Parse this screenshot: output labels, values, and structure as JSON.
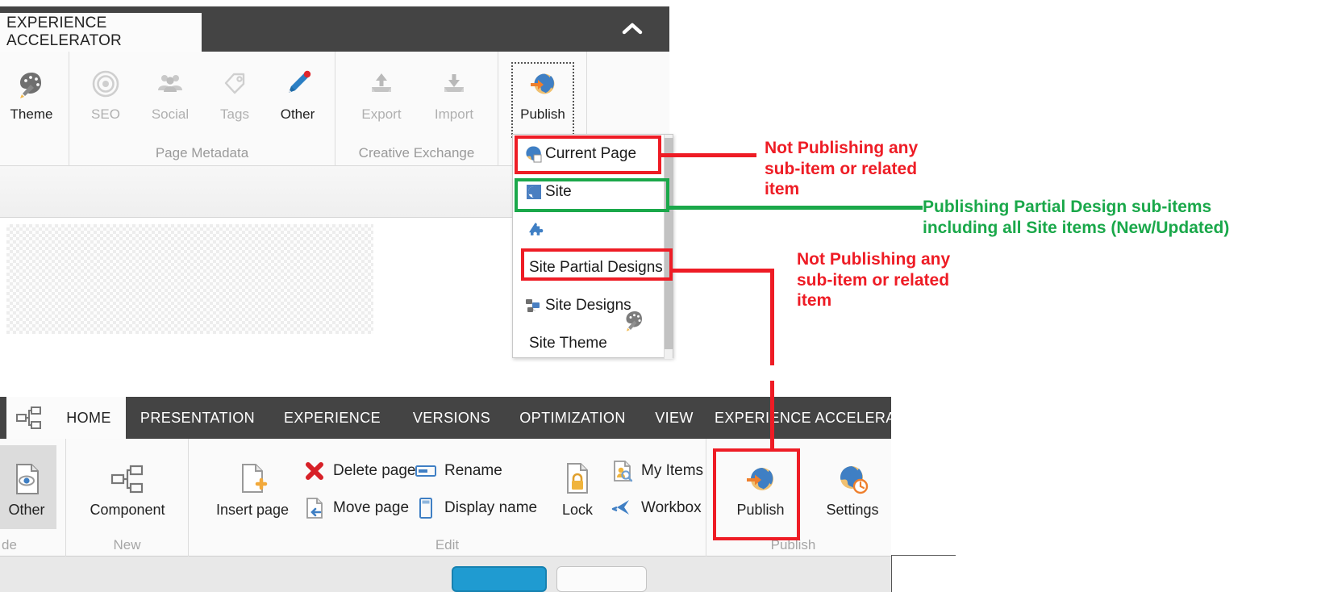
{
  "top_ribbon": {
    "tab_label": "EXPERIENCE ACCELERATOR",
    "collapse_icon": "chevron-up-icon",
    "groups": [
      {
        "label": "",
        "buttons": [
          {
            "label": "Theme",
            "icon": "palette-icon",
            "enabled": true
          }
        ]
      },
      {
        "label": "Page Metadata",
        "buttons": [
          {
            "label": "SEO",
            "icon": "target-icon",
            "enabled": false
          },
          {
            "label": "Social",
            "icon": "people-icon",
            "enabled": false
          },
          {
            "label": "Tags",
            "icon": "tag-icon",
            "enabled": false
          },
          {
            "label": "Other",
            "icon": "pencil-icon",
            "enabled": true
          }
        ]
      },
      {
        "label": "Creative Exchange",
        "buttons": [
          {
            "label": "Export",
            "icon": "export-up-icon",
            "enabled": false
          },
          {
            "label": "Import",
            "icon": "import-down-icon",
            "enabled": false
          }
        ]
      },
      {
        "label": "",
        "buttons": [
          {
            "label": "Publish",
            "icon": "globe-publish-icon",
            "enabled": true,
            "selected": true
          }
        ]
      }
    ]
  },
  "publish_dropdown": {
    "items": [
      {
        "label": "Current Page",
        "icon": "globe-page-icon"
      },
      {
        "label": "Site",
        "icon": "site-globe-icon"
      },
      {
        "label": "",
        "icon": "puzzle-icon"
      },
      {
        "label": "Site Partial Designs",
        "icon": ""
      },
      {
        "label": "Site Designs",
        "icon": "designs-icon"
      },
      {
        "label": "Site Theme",
        "icon": "theme-palette-icon"
      }
    ]
  },
  "bottom_ribbon": {
    "nav_icon": "sitemap-icon",
    "tabs": [
      {
        "label": "HOME",
        "active": true
      },
      {
        "label": "PRESENTATION",
        "active": false
      },
      {
        "label": "EXPERIENCE",
        "active": false
      },
      {
        "label": "VERSIONS",
        "active": false
      },
      {
        "label": "OPTIMIZATION",
        "active": false
      },
      {
        "label": "VIEW",
        "active": false
      },
      {
        "label": "EXPERIENCE ACCELERATOR",
        "active": false
      }
    ],
    "groups": [
      {
        "label": "de",
        "big": [
          {
            "label": "Other",
            "icon": "page-eye-icon",
            "selected": true
          }
        ],
        "small": []
      },
      {
        "label": "New",
        "big": [
          {
            "label": "Component",
            "icon": "component-icon"
          }
        ],
        "small": []
      },
      {
        "label": "Edit",
        "big": [
          {
            "label": "Insert page",
            "icon": "insert-page-icon"
          },
          {
            "label": "Lock",
            "icon": "lock-page-icon"
          }
        ],
        "small": [
          {
            "label": "Delete page",
            "icon": "red-x-icon"
          },
          {
            "label": "Move page",
            "icon": "move-page-icon"
          },
          {
            "label": "Rename",
            "icon": "rename-icon"
          },
          {
            "label": "Display name",
            "icon": "display-name-icon"
          },
          {
            "label": "My Items",
            "icon": "my-items-icon"
          },
          {
            "label": "Workbox",
            "icon": "workbox-icon"
          }
        ]
      },
      {
        "label": "Publish",
        "big": [
          {
            "label": "Publish",
            "icon": "globe-publish-icon",
            "highlighted": true
          },
          {
            "label": "Settings",
            "icon": "globe-clock-icon"
          }
        ],
        "small": []
      }
    ]
  },
  "annotations": [
    {
      "id": "ann-current-page",
      "color": "#ee1c25",
      "text": "Not Publishing any\nsub-item or related\nitem"
    },
    {
      "id": "ann-site",
      "color": "#1aa84a",
      "text": "Publishing Partial Design sub-items\nincluding all Site items (New/Updated)"
    },
    {
      "id": "ann-site-partial-designs",
      "color": "#ee1c25",
      "text": "Not Publishing any\nsub-item or related\nitem"
    }
  ],
  "colors": {
    "red": "#ee1c25",
    "green": "#1aa84a",
    "ribbon_dark": "#444444",
    "accent_blue": "#1f9bd1"
  }
}
